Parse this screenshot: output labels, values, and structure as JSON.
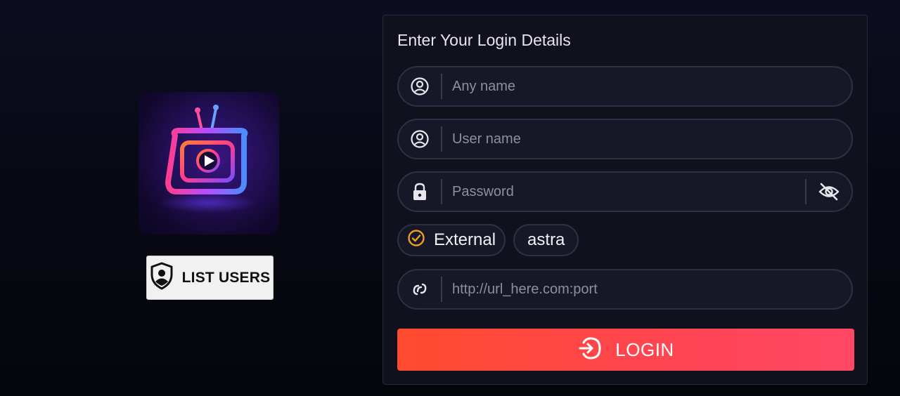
{
  "login_panel": {
    "title": "Enter Your Login Details",
    "fields": {
      "any_name": {
        "placeholder": "Any name",
        "value": "",
        "icon": "user-circle-icon"
      },
      "user_name": {
        "placeholder": "User name",
        "value": "",
        "icon": "user-circle-icon"
      },
      "password": {
        "placeholder": "Password",
        "value": "",
        "icon": "lock-icon",
        "toggle_icon": "eye-off-icon"
      },
      "url": {
        "placeholder": "http://url_here.com:port",
        "value": "",
        "icon": "link-icon"
      }
    },
    "options": [
      {
        "label": "External",
        "selected": true,
        "icon": "check-circle-icon"
      },
      {
        "label": "astra",
        "selected": false
      }
    ],
    "login_button": {
      "label": "LOGIN",
      "icon": "login-arrow-icon"
    }
  },
  "sidebar": {
    "logo": "tv-play-logo",
    "list_users_button": {
      "label": "LIST USERS",
      "icon": "shield-user-icon"
    }
  },
  "colors": {
    "accent_start": "#ff4b2e",
    "accent_end": "#ff4766",
    "check_orange": "#f0a020",
    "panel_bg": "#10111d"
  }
}
